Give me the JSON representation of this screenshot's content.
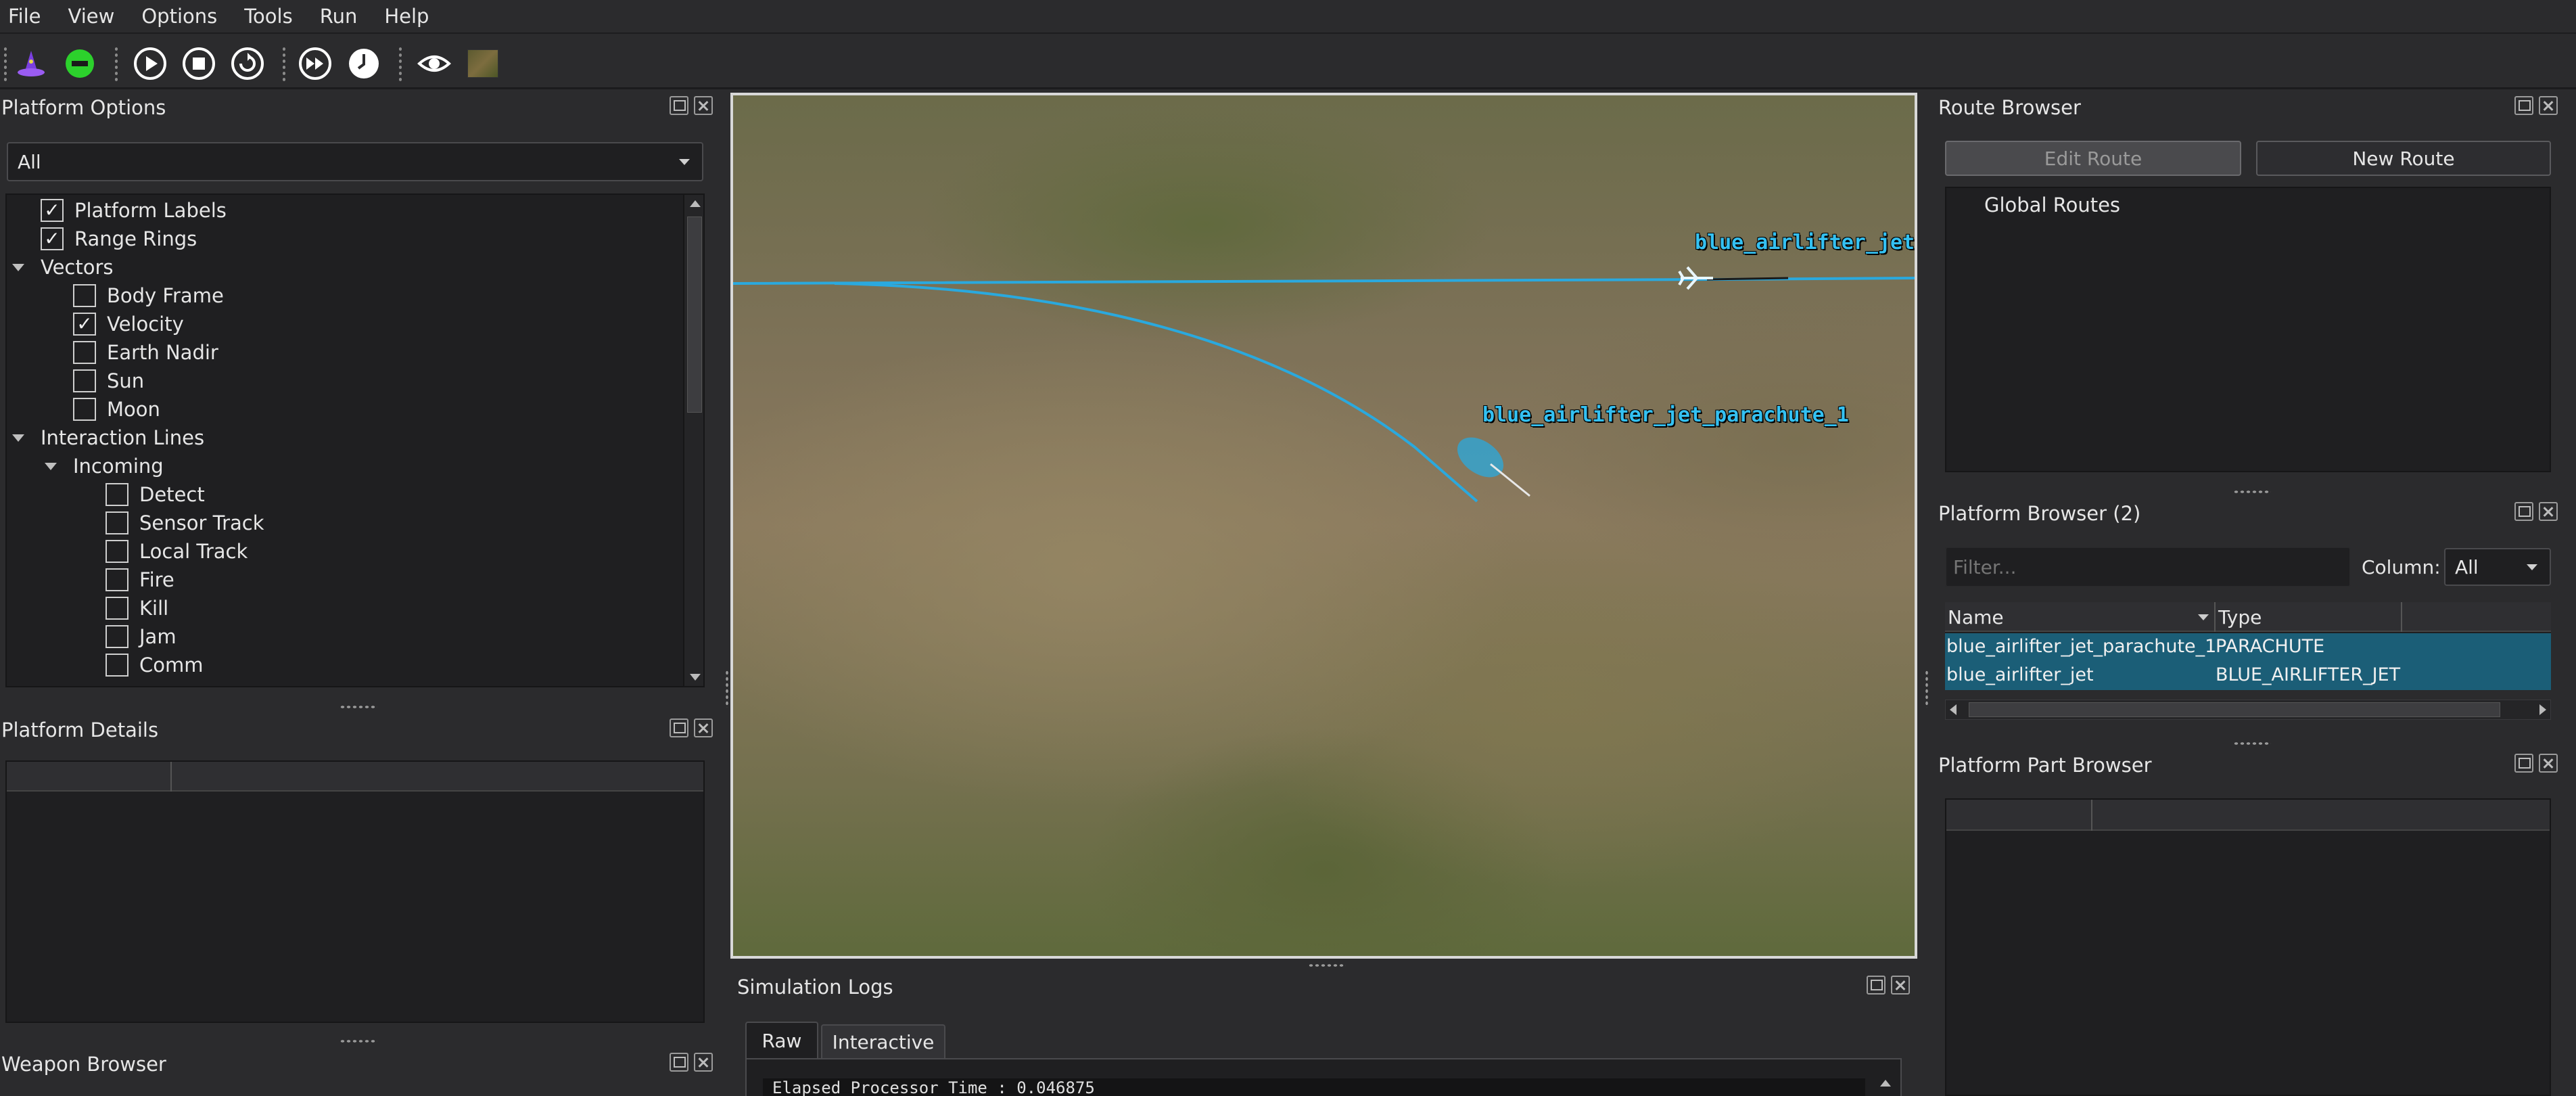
{
  "menu": [
    "File",
    "View",
    "Options",
    "Tools",
    "Run",
    "Help"
  ],
  "toolbar": {
    "icons": [
      "wizard-hat-icon",
      "minus-circle-icon",
      "play-icon",
      "stop-icon",
      "reset-icon",
      "fast-forward-icon",
      "clock-icon",
      "eye-icon",
      "map-thumbnail-icon"
    ]
  },
  "platform_options": {
    "title": "Platform Options",
    "filter_value": "All",
    "tree": [
      {
        "label": "Platform Labels",
        "type": "checkbox",
        "checked": true
      },
      {
        "label": "Range Rings",
        "type": "checkbox",
        "checked": true
      },
      {
        "label": "Vectors",
        "type": "group"
      },
      {
        "label": "Body Frame",
        "type": "checkbox",
        "checked": false
      },
      {
        "label": "Velocity",
        "type": "checkbox",
        "checked": true
      },
      {
        "label": "Earth Nadir",
        "type": "checkbox",
        "checked": false
      },
      {
        "label": "Sun",
        "type": "checkbox",
        "checked": false
      },
      {
        "label": "Moon",
        "type": "checkbox",
        "checked": false
      },
      {
        "label": "Interaction Lines",
        "type": "group"
      },
      {
        "label": "Incoming",
        "type": "group"
      },
      {
        "label": "Detect",
        "type": "checkbox",
        "checked": false
      },
      {
        "label": "Sensor Track",
        "type": "checkbox",
        "checked": false
      },
      {
        "label": "Local Track",
        "type": "checkbox",
        "checked": false
      },
      {
        "label": "Fire",
        "type": "checkbox",
        "checked": false
      },
      {
        "label": "Kill",
        "type": "checkbox",
        "checked": false
      },
      {
        "label": "Jam",
        "type": "checkbox",
        "checked": false
      },
      {
        "label": "Comm",
        "type": "checkbox",
        "checked": false
      }
    ]
  },
  "platform_details": {
    "title": "Platform Details"
  },
  "weapon_browser": {
    "title": "Weapon Browser"
  },
  "viewport": {
    "labels": [
      "blue_airlifter_jet",
      "blue_airlifter_jet_parachute_1"
    ]
  },
  "simulation_logs": {
    "title": "Simulation Logs",
    "tabs": [
      "Raw",
      "Interactive"
    ],
    "first_line": "Elapsed Processor Time : 0.046875"
  },
  "route_browser": {
    "title": "Route Browser",
    "edit_button": "Edit Route",
    "new_button": "New Route",
    "tree_item": "Global Routes"
  },
  "platform_browser": {
    "title": "Platform Browser (2)",
    "filter_placeholder": "Filter...",
    "column_label": "Column:",
    "column_value": "All",
    "headers": [
      "Name",
      "Type"
    ],
    "rows": [
      {
        "name": "blue_airlifter_jet_parachute_1",
        "type": "PARACHUTE"
      },
      {
        "name": "blue_airlifter_jet",
        "type": "BLUE_AIRLIFTER_JET"
      }
    ]
  },
  "platform_part_browser": {
    "title": "Platform Part Browser"
  },
  "colors": {
    "accent": "#34c1f2",
    "selection": "#1b5e77",
    "background": "#2b2b2d"
  }
}
